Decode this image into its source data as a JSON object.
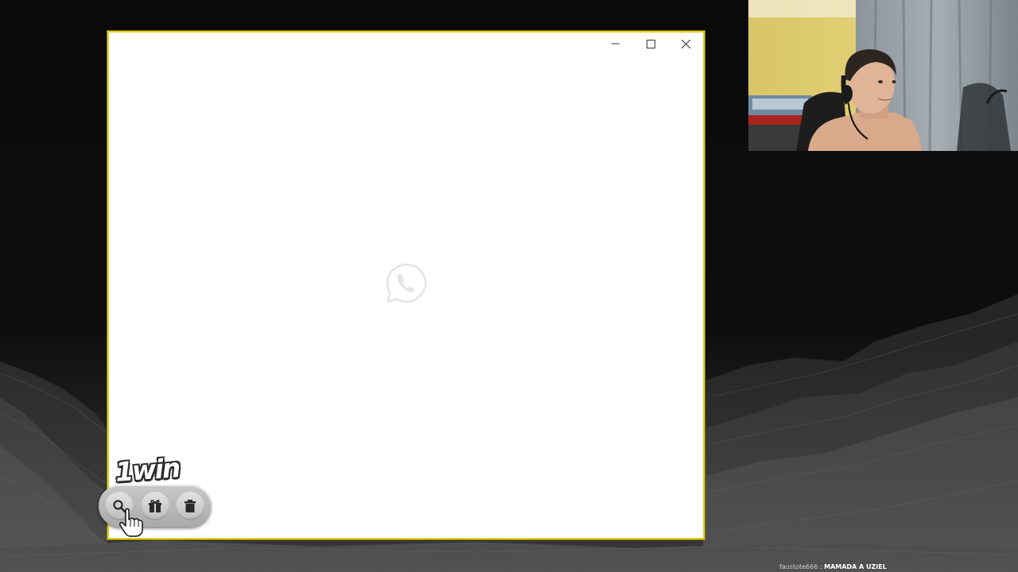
{
  "window": {
    "controls": {
      "minimize_icon": "minimize-icon",
      "maximize_icon": "maximize-icon",
      "close_icon": "close-icon"
    },
    "splash_icon": "whatsapp-icon",
    "border_color": "#e3d21f"
  },
  "overlay": {
    "sponsor": {
      "brand": "1win",
      "buttons": [
        {
          "icon": "search-icon"
        },
        {
          "icon": "gift-icon"
        },
        {
          "icon": "trash-icon"
        }
      ]
    },
    "chat": {
      "user": "faustote666",
      "separator": " : ",
      "message": "MAMADA A UZIEL"
    }
  },
  "colors": {
    "background": "#0b0b0c",
    "window_border": "#e3d21f",
    "window_bg": "#ffffff"
  }
}
